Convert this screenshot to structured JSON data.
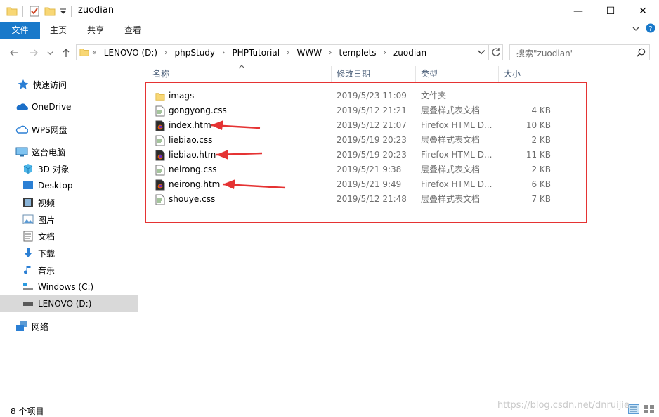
{
  "window": {
    "title": "zuodian",
    "controls": {
      "minimize": "—",
      "maximize": "☐",
      "close": "✕"
    }
  },
  "ribbon": {
    "tabs": [
      "文件",
      "主页",
      "共享",
      "查看"
    ]
  },
  "address": {
    "prefix": "«",
    "crumbs": [
      "LENOVO (D:)",
      "phpStudy",
      "PHPTutorial",
      "WWW",
      "templets",
      "zuodian"
    ],
    "search_placeholder": "搜索\"zuodian\""
  },
  "sidebar": {
    "items": [
      {
        "label": "快速访问",
        "icon": "star-icon"
      },
      {
        "label": "OneDrive",
        "icon": "cloud-icon"
      },
      {
        "label": "WPS网盘",
        "icon": "wps-cloud-icon"
      },
      {
        "label": "这台电脑",
        "icon": "computer-icon"
      },
      {
        "label": "3D 对象",
        "icon": "3d-objects-icon"
      },
      {
        "label": "Desktop",
        "icon": "desktop-icon"
      },
      {
        "label": "视频",
        "icon": "video-icon"
      },
      {
        "label": "图片",
        "icon": "pictures-icon"
      },
      {
        "label": "文档",
        "icon": "documents-icon"
      },
      {
        "label": "下载",
        "icon": "download-icon"
      },
      {
        "label": "音乐",
        "icon": "music-icon"
      },
      {
        "label": "Windows (C:)",
        "icon": "drive-c-icon"
      },
      {
        "label": "LENOVO (D:)",
        "icon": "drive-d-icon"
      },
      {
        "label": "网络",
        "icon": "network-icon"
      }
    ]
  },
  "columns": {
    "name": "名称",
    "date": "修改日期",
    "type": "类型",
    "size": "大小"
  },
  "files": [
    {
      "name": "imags",
      "date": "2019/5/23 11:09",
      "type": "文件夹",
      "size": "",
      "icon": "folder-icon"
    },
    {
      "name": "gongyong.css",
      "date": "2019/5/12 21:21",
      "type": "层叠样式表文档",
      "size": "4 KB",
      "icon": "css-file-icon"
    },
    {
      "name": "index.htm",
      "date": "2019/5/12 21:07",
      "type": "Firefox HTML D...",
      "size": "10 KB",
      "icon": "firefox-html-icon"
    },
    {
      "name": "liebiao.css",
      "date": "2019/5/19 20:23",
      "type": "层叠样式表文档",
      "size": "2 KB",
      "icon": "css-file-icon"
    },
    {
      "name": "liebiao.htm",
      "date": "2019/5/19 20:23",
      "type": "Firefox HTML D...",
      "size": "11 KB",
      "icon": "firefox-html-icon"
    },
    {
      "name": "neirong.css",
      "date": "2019/5/21 9:38",
      "type": "层叠样式表文档",
      "size": "2 KB",
      "icon": "css-file-icon"
    },
    {
      "name": "neirong.htm",
      "date": "2019/5/21 9:49",
      "type": "Firefox HTML D...",
      "size": "6 KB",
      "icon": "firefox-html-icon"
    },
    {
      "name": "shouye.css",
      "date": "2019/5/12 21:48",
      "type": "层叠样式表文档",
      "size": "7 KB",
      "icon": "css-file-icon"
    }
  ],
  "status": {
    "item_count": "8 个项目"
  },
  "watermark": "https://blog.csdn.net/dnruijie",
  "colors": {
    "accent": "#1979ca",
    "highlight_box": "#e53333",
    "arrow": "#e53333",
    "selected": "#d9d9d9"
  }
}
